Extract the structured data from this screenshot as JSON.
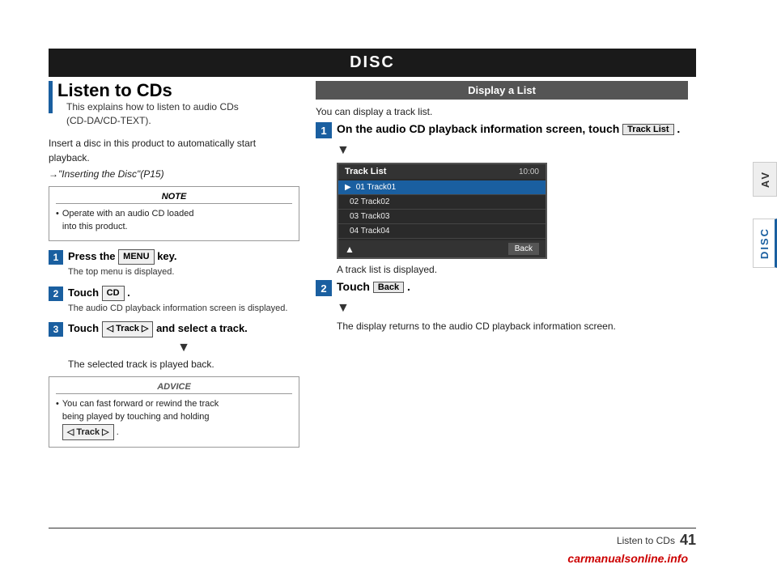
{
  "page": {
    "title": "DISC",
    "page_number": "41",
    "page_label": "Listen to CDs"
  },
  "left_section": {
    "title": "Listen to CDs",
    "subtitle_line1": "This explains how to listen to audio CDs",
    "subtitle_line2": "(CD-DA/CD-TEXT).",
    "body_text": "Insert a disc in this product to automatically start playback.",
    "arrow_ref": "→\"Inserting the Disc\"(P15)",
    "note": {
      "title": "NOTE",
      "bullet1": "Operate with an audio CD loaded",
      "bullet1b": "into this product."
    },
    "step1": {
      "number": "1",
      "main": "Press the",
      "key": "MENU",
      "main2": "key.",
      "sub": "The top menu is displayed."
    },
    "step2": {
      "number": "2",
      "main": "Touch",
      "key": "CD",
      "sub": "The audio CD playback information screen is displayed."
    },
    "step3": {
      "number": "3",
      "main_before": "Touch",
      "key": "◁ Track ▷",
      "main_after": "and select a track.",
      "sub": "The selected track is played back."
    },
    "advice": {
      "title": "ADVICE",
      "text1": "You can fast forward or rewind the track",
      "text2": "being played by touching and holding",
      "key": "◁ Track ▷",
      "text3": "."
    }
  },
  "right_section": {
    "header": "Display a List",
    "intro": "You can display a track list.",
    "step1": {
      "number": "1",
      "main": "On the audio CD playback information screen, touch",
      "btn": "Track List",
      "sub": "A track list is displayed."
    },
    "step2": {
      "number": "2",
      "main": "Touch",
      "btn": "Back",
      "sub": "The display returns to the audio CD playback information screen."
    },
    "screen": {
      "title": "Track List",
      "time": "10:00",
      "tracks": [
        {
          "label": "01 Track01",
          "active": true
        },
        {
          "label": "02 Track02",
          "active": false
        },
        {
          "label": "03 Track03",
          "active": false
        },
        {
          "label": "04 Track04",
          "active": false
        }
      ],
      "back_btn": "Back"
    }
  },
  "sidebar": {
    "av_label": "AV",
    "disc_label": "DISC"
  },
  "watermark": "carmanualsonline.info"
}
